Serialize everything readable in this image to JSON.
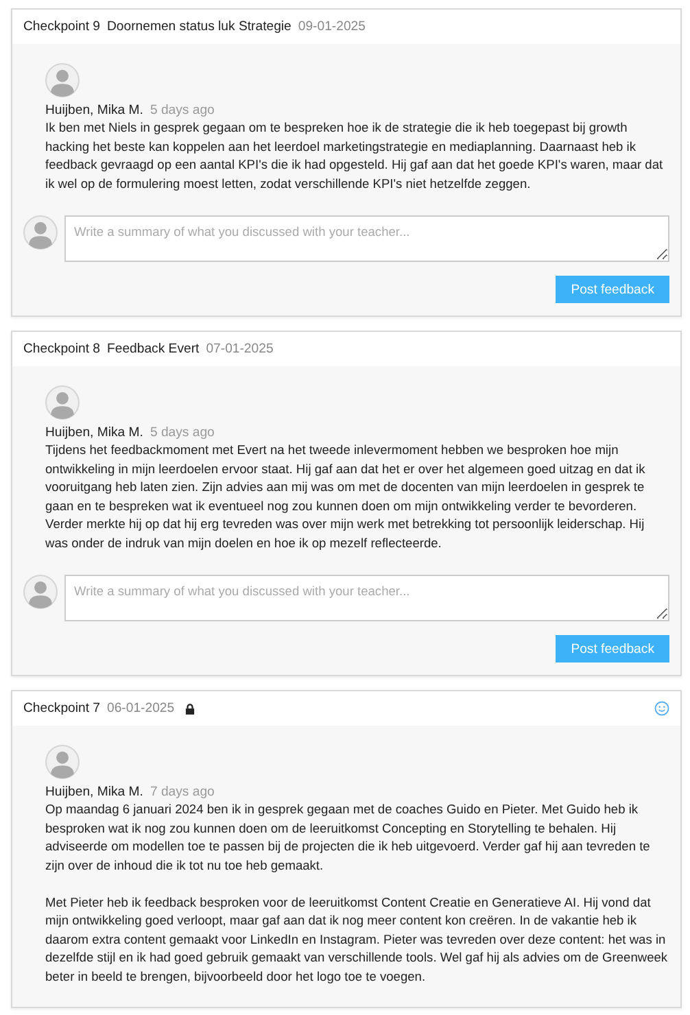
{
  "checkpoints": [
    {
      "label": "Checkpoint 9",
      "title": "Doornemen status luk Strategie",
      "date": "09-01-2025",
      "locked": false,
      "reaction": false,
      "comments": [
        {
          "author": "Huijben, Mika M.",
          "time": "5 days ago",
          "paragraphs": [
            "Ik ben met Niels in gesprek gegaan om te bespreken hoe ik de strategie die ik heb toegepast bij growth hacking het beste kan koppelen aan het leerdoel marketingstrategie en mediaplanning. Daarnaast heb ik feedback gevraagd op een aantal KPI's die ik had opgesteld. Hij gaf aan dat het goede KPI's waren, maar dat ik wel op de formulering moest letten, zodat verschillende KPI's niet hetzelfde zeggen."
          ]
        }
      ],
      "form": {
        "placeholder": "Write a summary of what you discussed with your teacher...",
        "button": "Post feedback"
      }
    },
    {
      "label": "Checkpoint 8",
      "title": "Feedback Evert",
      "date": "07-01-2025",
      "locked": false,
      "reaction": false,
      "comments": [
        {
          "author": "Huijben, Mika M.",
          "time": "5 days ago",
          "paragraphs": [
            "Tijdens het feedbackmoment met Evert na het tweede inlevermoment hebben we besproken hoe mijn ontwikkeling in mijn leerdoelen ervoor staat. Hij gaf aan dat het er over het algemeen goed uitzag en dat ik vooruitgang heb laten zien. Zijn advies aan mij was om met de docenten van mijn leerdoelen in gesprek te gaan en te bespreken wat ik eventueel nog zou kunnen doen om mijn ontwikkeling verder te bevorderen. Verder merkte hij op dat hij erg tevreden was over mijn werk met betrekking tot persoonlijk leiderschap. Hij was onder de indruk van mijn doelen en hoe ik op mezelf reflecteerde."
          ]
        }
      ],
      "form": {
        "placeholder": "Write a summary of what you discussed with your teacher...",
        "button": "Post feedback"
      }
    },
    {
      "label": "Checkpoint 7",
      "date": "06-01-2025",
      "locked": true,
      "reaction": true,
      "comments": [
        {
          "author": "Huijben, Mika M.",
          "time": "7 days ago",
          "paragraphs": [
            "Op maandag 6 januari 2024 ben ik in gesprek gegaan met de coaches Guido en Pieter. Met Guido heb ik besproken wat ik nog zou kunnen doen om de leeruitkomst Concepting en Storytelling te behalen. Hij adviseerde om modellen toe te passen bij de projecten die ik heb uitgevoerd. Verder gaf hij aan tevreden te zijn over de inhoud die ik tot nu toe heb gemaakt.",
            "Met Pieter heb ik feedback besproken voor de leeruitkomst Content Creatie en Generatieve AI. Hij vond dat mijn ontwikkeling goed verloopt, maar gaf aan dat ik nog meer content kon creëren. In de vakantie heb ik daarom extra content gemaakt voor LinkedIn en Instagram. Pieter was tevreden over deze content: het was in dezelfde stijl en ik had goed gebruik gemaakt van verschillende tools. Wel gaf hij als advies om de Greenweek beter in beeld te brengen, bijvoorbeeld door het logo toe te voegen."
          ]
        }
      ]
    }
  ]
}
